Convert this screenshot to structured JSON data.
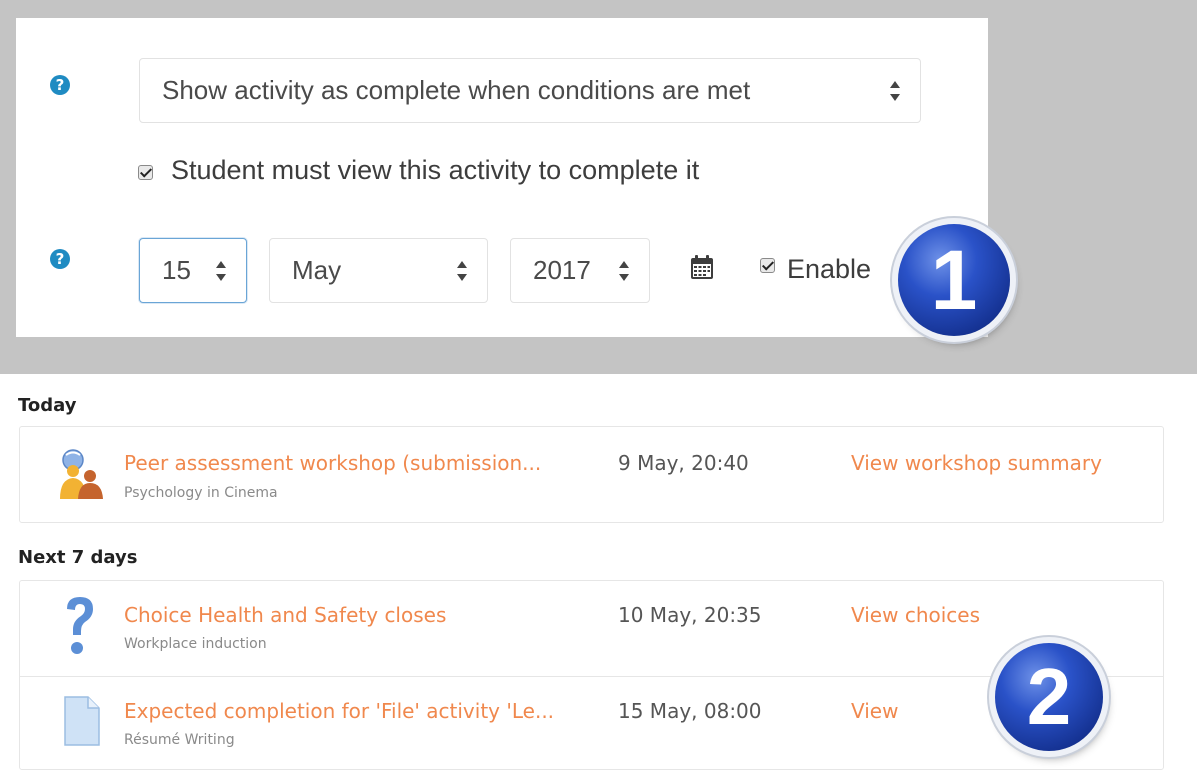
{
  "completion": {
    "tracking_select": {
      "value": "Show activity as complete when conditions are met"
    },
    "view_required": {
      "checked": true,
      "label": "Student must view this activity to complete it"
    },
    "expected_date": {
      "day": "15",
      "month": "May",
      "year": "2017",
      "enable": {
        "checked": true,
        "label": "Enable"
      }
    },
    "help_icon_glyph": "?"
  },
  "badges": {
    "one": "1",
    "two": "2"
  },
  "timeline": {
    "sections": [
      {
        "title": "Today",
        "events": [
          {
            "icon": "workshop-icon",
            "title": "Peer assessment workshop (submission...",
            "course": "Psychology in Cinema",
            "date": "9 May, 20:40",
            "action": "View workshop summary"
          }
        ]
      },
      {
        "title": "Next 7 days",
        "events": [
          {
            "icon": "choice-icon",
            "title": "Choice Health and Safety closes",
            "course": "Workplace induction",
            "date": "10 May, 20:35",
            "action": "View choices"
          },
          {
            "icon": "file-icon",
            "title": "Expected completion for 'File' activity 'Le...",
            "course": "Résumé Writing",
            "date": "15 May, 08:00",
            "action": "View"
          }
        ]
      }
    ]
  },
  "colors": {
    "accent_link": "#f0884d",
    "help_blue": "#1f8bc2",
    "badge_blue": "#2a52c8"
  }
}
